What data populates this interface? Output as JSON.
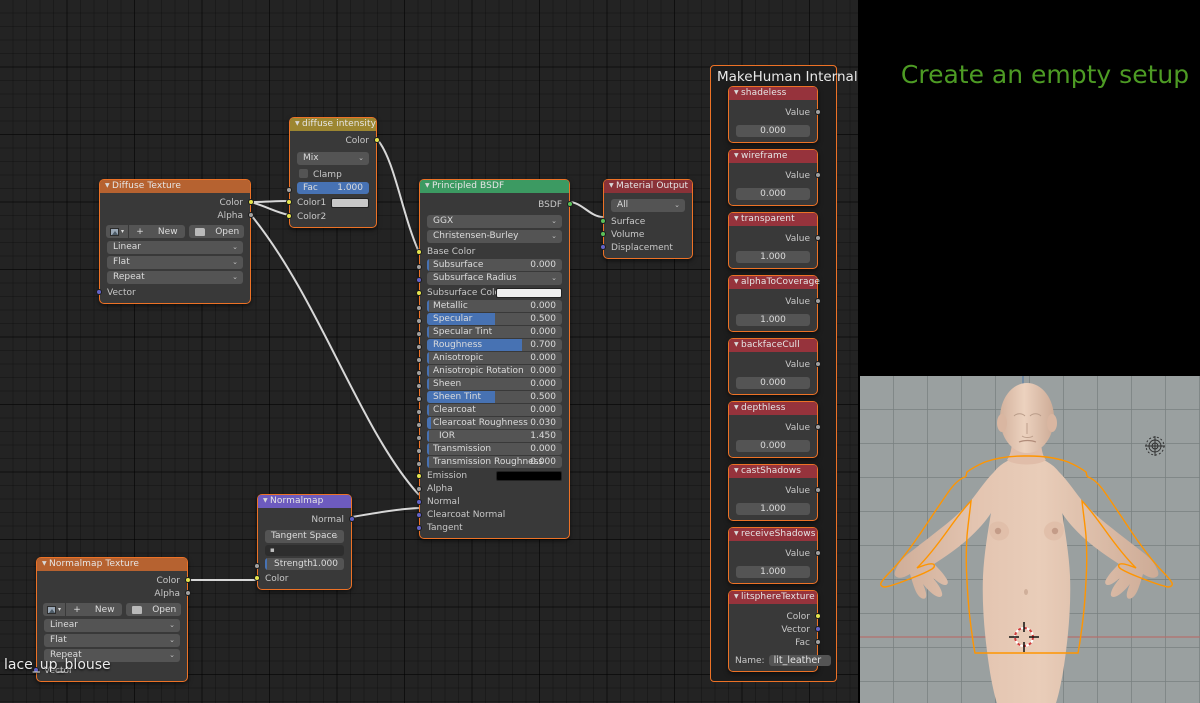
{
  "app": {
    "editor": "blender-node-editor"
  },
  "object_label": "lace_up_blouse",
  "slide": {
    "title": "Create an empty setup",
    "title_color": "#4d9b24"
  },
  "frame": {
    "label": "MakeHuman Internal"
  },
  "nodes": {
    "diffuse_texture": {
      "title": "Diffuse Texture",
      "outputs": [
        "Color",
        "Alpha"
      ],
      "buttons": {
        "new": "New",
        "open": "Open"
      },
      "dropdowns": [
        "Linear",
        "Flat",
        "Repeat"
      ],
      "inputs": [
        "Vector"
      ]
    },
    "diffuse_intensity": {
      "title": "diffuse intensity",
      "outputs": [
        "Color"
      ],
      "blend_mode": "Mix",
      "clamp_label": "Clamp",
      "fac": {
        "label": "Fac",
        "value": "1.000"
      },
      "color1": {
        "label": "Color1",
        "swatch": "#c8c8c8"
      },
      "color2": {
        "label": "Color2"
      }
    },
    "principled_bsdf": {
      "title": "Principled BSDF",
      "output": "BSDF",
      "distribution": "GGX",
      "subsurface_method": "Christensen-Burley",
      "inputs": [
        {
          "label": "Base Color",
          "type": "color",
          "socket": "yellow"
        },
        {
          "label": "Subsurface",
          "type": "slider",
          "value": "0.000",
          "fill": 0,
          "socket": "grey"
        },
        {
          "label": "Subsurface Radius",
          "type": "dropdown",
          "socket": "purple"
        },
        {
          "label": "Subsurface Color",
          "type": "swatch",
          "swatch": "#eeeeee",
          "socket": "yellow"
        },
        {
          "label": "Metallic",
          "type": "slider",
          "value": "0.000",
          "fill": 0,
          "socket": "grey"
        },
        {
          "label": "Specular",
          "type": "slider",
          "value": "0.500",
          "fill": 50,
          "socket": "grey"
        },
        {
          "label": "Specular Tint",
          "type": "slider",
          "value": "0.000",
          "fill": 0,
          "socket": "grey"
        },
        {
          "label": "Roughness",
          "type": "slider",
          "value": "0.700",
          "fill": 70,
          "socket": "grey"
        },
        {
          "label": "Anisotropic",
          "type": "slider",
          "value": "0.000",
          "fill": 0,
          "socket": "grey"
        },
        {
          "label": "Anisotropic Rotation",
          "type": "slider",
          "value": "0.000",
          "fill": 0,
          "socket": "grey"
        },
        {
          "label": "Sheen",
          "type": "slider",
          "value": "0.000",
          "fill": 0,
          "socket": "grey"
        },
        {
          "label": "Sheen Tint",
          "type": "slider",
          "value": "0.500",
          "fill": 50,
          "socket": "grey"
        },
        {
          "label": "Clearcoat",
          "type": "slider",
          "value": "0.000",
          "fill": 0,
          "socket": "grey"
        },
        {
          "label": "Clearcoat Roughness",
          "type": "slider",
          "value": "0.030",
          "fill": 3,
          "socket": "grey"
        },
        {
          "label": "IOR",
          "type": "slider-center",
          "value": "1.450",
          "fill": 0,
          "socket": "grey"
        },
        {
          "label": "Transmission",
          "type": "slider",
          "value": "0.000",
          "fill": 0,
          "socket": "grey"
        },
        {
          "label": "Transmission Roughness",
          "type": "slider",
          "value": "0.000",
          "fill": 0,
          "socket": "grey"
        },
        {
          "label": "Emission",
          "type": "swatch",
          "swatch": "#000000",
          "socket": "yellow"
        },
        {
          "label": "Alpha",
          "type": "plain",
          "socket": "grey"
        },
        {
          "label": "Normal",
          "type": "plain",
          "socket": "purple"
        },
        {
          "label": "Clearcoat Normal",
          "type": "plain",
          "socket": "purple"
        },
        {
          "label": "Tangent",
          "type": "plain",
          "socket": "purple"
        }
      ]
    },
    "material_output": {
      "title": "Material Output",
      "target": "All",
      "inputs": [
        "Surface",
        "Volume",
        "Displacement"
      ]
    },
    "normalmap": {
      "title": "Normalmap",
      "outputs": [
        "Normal"
      ],
      "space": "Tangent Space",
      "uv_map": "",
      "strength": {
        "label": "Strength",
        "value": "1.000"
      },
      "color_input": "Color"
    },
    "normalmap_texture": {
      "title": "Normalmap Texture",
      "outputs": [
        "Color",
        "Alpha"
      ],
      "buttons": {
        "new": "New",
        "open": "Open"
      },
      "dropdowns": [
        "Linear",
        "Flat",
        "Repeat"
      ],
      "inputs": [
        "Vector"
      ]
    }
  },
  "makehuman_nodes": [
    {
      "title": "shadeless",
      "kind": "value",
      "socket_label": "Value",
      "value": "0.000"
    },
    {
      "title": "wireframe",
      "kind": "value",
      "socket_label": "Value",
      "value": "0.000"
    },
    {
      "title": "transparent",
      "kind": "value",
      "socket_label": "Value",
      "value": "1.000"
    },
    {
      "title": "alphaToCoverage",
      "kind": "value",
      "socket_label": "Value",
      "value": "1.000"
    },
    {
      "title": "backfaceCull",
      "kind": "value",
      "socket_label": "Value",
      "value": "0.000"
    },
    {
      "title": "depthless",
      "kind": "value",
      "socket_label": "Value",
      "value": "0.000"
    },
    {
      "title": "castShadows",
      "kind": "value",
      "socket_label": "Value",
      "value": "1.000"
    },
    {
      "title": "receiveShadows",
      "kind": "value",
      "socket_label": "Value",
      "value": "1.000"
    },
    {
      "title": "litsphereTexture",
      "kind": "texture",
      "outputs": [
        "Color",
        "Vector",
        "Fac"
      ],
      "name_label": "Name:",
      "name_value": "lit_leather"
    }
  ],
  "colors": {
    "node_body": "#393939",
    "node_border_selected": "#ed7226",
    "header_orange": "#b66230",
    "header_yellow": "#9c8631",
    "header_green": "#3c9a62",
    "header_red": "#96333c",
    "header_purple": "#6d5bbf",
    "slider_fill": "#4772b3",
    "canvas": "#232323",
    "viewport_bg": "#9aa0a0",
    "selection_outline": "#ff9500"
  }
}
